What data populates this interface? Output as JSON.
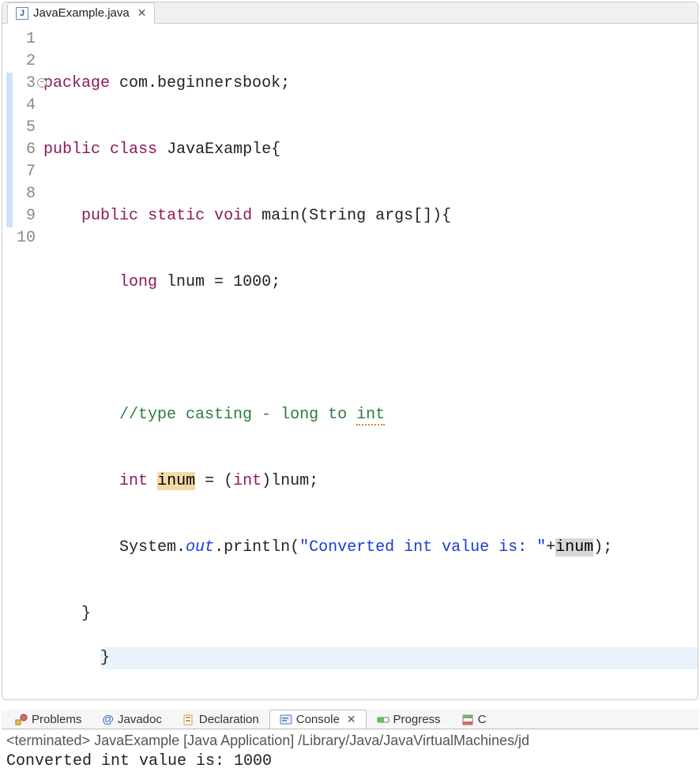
{
  "editor": {
    "tab": {
      "filename": "JavaExample.java"
    },
    "code": {
      "l1": {
        "kw1": "package",
        "rest": " com.beginnersbook;"
      },
      "l2": {
        "kw1": "public",
        "kw2": "class",
        "name": " JavaExample{"
      },
      "l3": {
        "kw1": "public",
        "kw2": "static",
        "kw3": "void",
        "sig": " main(String args[]){"
      },
      "l4": {
        "kw1": "long",
        "rest": " lnum = 1000;"
      },
      "l5": "",
      "l6": {
        "comment_a": "//type casting - long to ",
        "comment_warn": "int"
      },
      "l7": {
        "kw1": "int",
        "sp": " ",
        "var": "inum",
        "rest_a": " = (",
        "kw2": "int",
        "rest_b": ")lnum;"
      },
      "l8": {
        "a": "System.",
        "field": "out",
        "b": ".println(",
        "str": "\"Converted int value is: \"",
        "c": "+",
        "ref": "inum",
        "d": ");"
      },
      "l9": "    }",
      "l10": "}"
    },
    "line_numbers": [
      "1",
      "2",
      "3",
      "4",
      "5",
      "6",
      "7",
      "8",
      "9",
      "10"
    ]
  },
  "bottom": {
    "tabs": {
      "problems": "Problems",
      "javadoc": "Javadoc",
      "declaration": "Declaration",
      "console": "Console",
      "progress": "Progress",
      "coverage_initial": "C"
    },
    "status": "<terminated> JavaExample [Java Application] /Library/Java/JavaVirtualMachines/jd",
    "output": "Converted int value is: 1000"
  }
}
